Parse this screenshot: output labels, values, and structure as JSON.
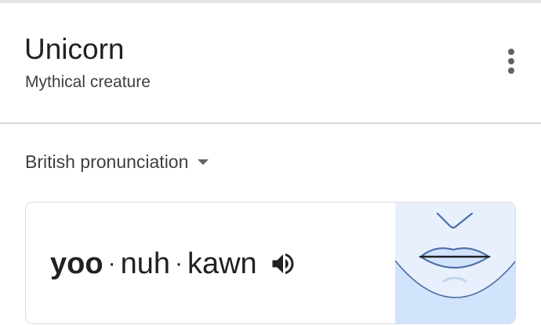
{
  "header": {
    "title": "Unicorn",
    "subtitle": "Mythical creature",
    "more_icon": "more-vert-icon"
  },
  "pronunciation": {
    "accent_label": "British pronunciation",
    "accent_dropdown_icon": "caret-down-icon",
    "syllables": [
      "yoo",
      "nuh",
      "kawn"
    ],
    "separator": "·",
    "speaker_icon": "volume-up-icon",
    "illustration": "mouth-illustration"
  },
  "colors": {
    "text_primary": "#202124",
    "text_secondary": "#3c4043",
    "divider": "#d8d9db",
    "illustration_bg": "#e8f0fe",
    "illustration_shade": "#d2e3fc",
    "illustration_line": "#4a6fa5"
  }
}
